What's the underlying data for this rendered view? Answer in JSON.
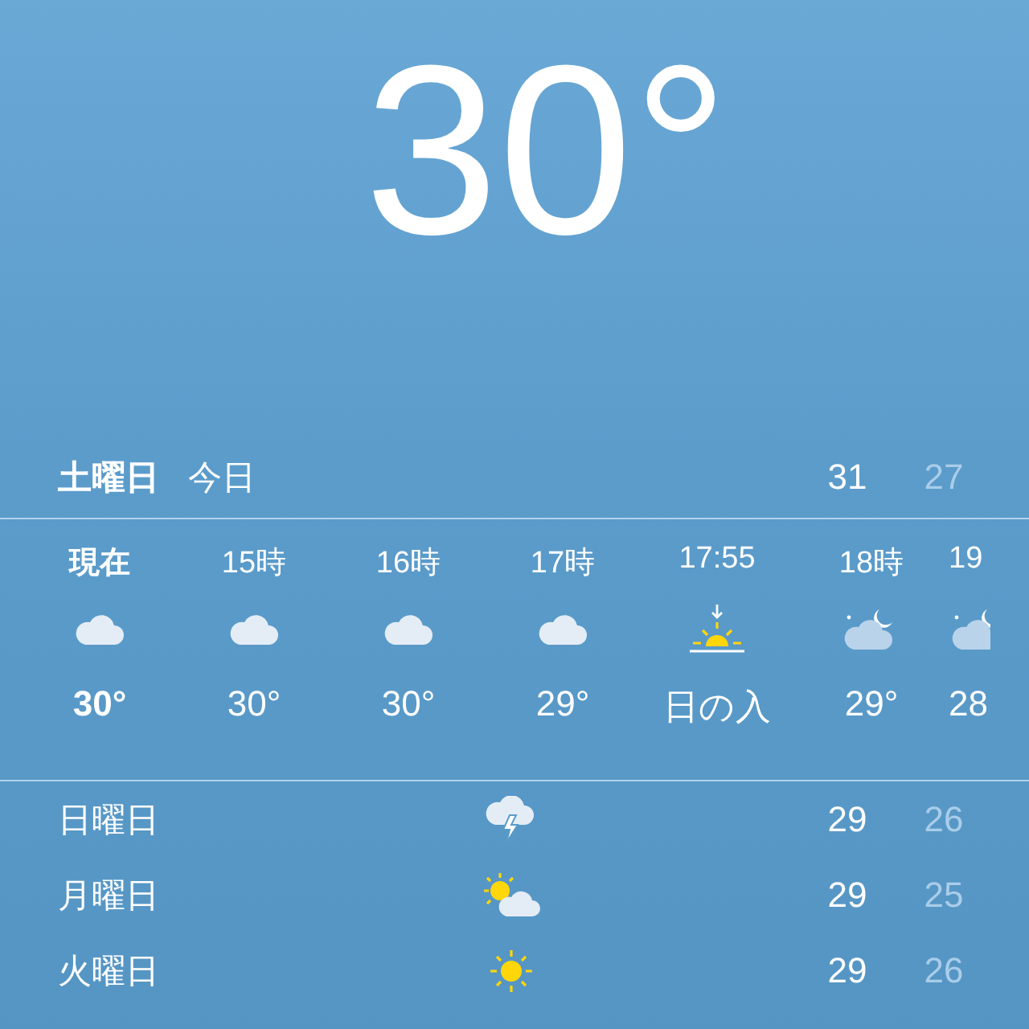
{
  "current": {
    "temperature": "30°"
  },
  "today": {
    "day": "土曜日",
    "label": "今日",
    "high": "31",
    "low": "27"
  },
  "hourly": [
    {
      "time": "現在",
      "kind": "cloud",
      "temp": "30°",
      "now": true
    },
    {
      "time": "15時",
      "kind": "cloud",
      "temp": "30°",
      "now": false
    },
    {
      "time": "16時",
      "kind": "cloud",
      "temp": "30°",
      "now": false
    },
    {
      "time": "17時",
      "kind": "cloud",
      "temp": "29°",
      "now": false
    },
    {
      "time": "17:55",
      "kind": "sunset",
      "temp": "日の入",
      "now": false
    },
    {
      "time": "18時",
      "kind": "cloud-moon",
      "temp": "29°",
      "now": false
    },
    {
      "time": "19",
      "kind": "cloud-moon",
      "temp": "28",
      "now": false
    }
  ],
  "daily": [
    {
      "day": "日曜日",
      "kind": "thunder",
      "high": "29",
      "low": "26"
    },
    {
      "day": "月曜日",
      "kind": "sun-cloud",
      "high": "29",
      "low": "25"
    },
    {
      "day": "火曜日",
      "kind": "sun",
      "high": "29",
      "low": "26"
    }
  ]
}
